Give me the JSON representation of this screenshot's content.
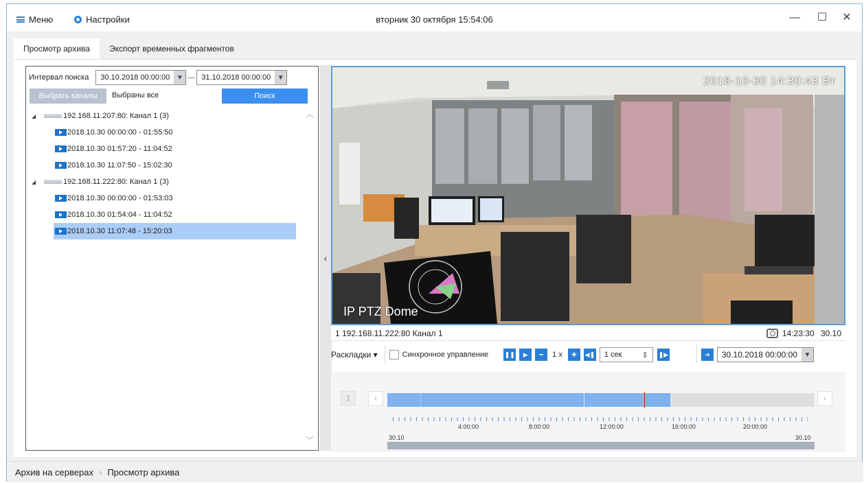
{
  "titlebar": {
    "menu_label": "Меню",
    "settings_label": "Настройки",
    "clock": "вторник 30 октября 15:54:06",
    "minimize_glyph": "—",
    "maximize_glyph": "☐",
    "close_glyph": "✕"
  },
  "tabs": [
    {
      "label": "Просмотр архива",
      "active": true
    },
    {
      "label": "Экспорт временных фрагментов",
      "active": false
    }
  ],
  "search": {
    "interval_label": "Интервал поиска",
    "from": "30.10.2018  00:00:00",
    "to": "31.10.2018  00:00:00",
    "select_channels": "Выбрать каналы",
    "selected_all": "Выбраны все",
    "search_button": "Поиск"
  },
  "tree": {
    "groups": [
      {
        "name": "192.168.11.207:80: Канал 1  (3)",
        "items": [
          "2018.10.30  00:00:00 - 01:55:50",
          "2018.10.30  01:57:20 - 11:04:52",
          "2018.10.30  11:07:50 - 15:02:30"
        ]
      },
      {
        "name": "192.168.11.222:80: Канал 1  (3)",
        "items": [
          "2018.10.30  00:00:00 - 01:53:03",
          "2018.10.30  01:54:04 - 11:04:52",
          "2018.10.30  11:07:48 - 15:20:03"
        ],
        "selected_index": 2
      }
    ]
  },
  "collapse_glyph": "‹",
  "video": {
    "osd_timestamp": "2018-10-30 14:30:43 Вт",
    "osd_camera": "IP PTZ Dome",
    "status_left": "1  192.168.11.222:80 Канал 1",
    "status_time": "14:23:30",
    "status_date": "30.10"
  },
  "controls": {
    "layouts_label": "Раскладки ▾",
    "sync_label": "Синхронное управление",
    "speed": "1 x",
    "step": "1 сек",
    "goto_datetime": "30.10.2018  00:00:00"
  },
  "timeline": {
    "page_number": "1",
    "tick_labels": [
      "4:00:00",
      "8:00:00",
      "12:00:00",
      "16:00:00",
      "20:00:00"
    ],
    "start_date": "30.10",
    "end_date": "30.10",
    "coverage_fraction": [
      0,
      0.662
    ],
    "playhead_fraction": 0.602
  },
  "breadcrumb": {
    "root": "Архив на серверах",
    "separator": "›",
    "current": "Просмотр архива"
  },
  "colors": {
    "accent": "#2a7fd4",
    "search_button": "#3b8ff0",
    "selection": "#aacdf7",
    "timeline_segment": "#7fb2ef",
    "playhead": "#d62020"
  }
}
